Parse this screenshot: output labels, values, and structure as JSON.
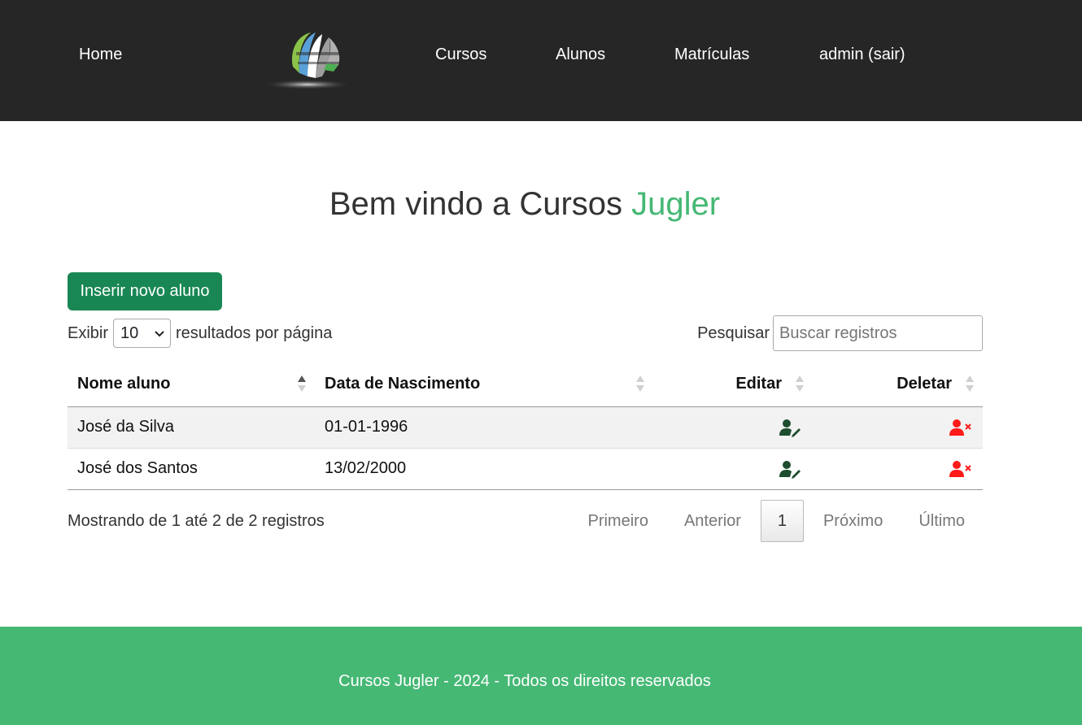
{
  "nav": {
    "home": "Home",
    "cursos": "Cursos",
    "alunos": "Alunos",
    "matriculas": "Matrículas",
    "admin": "admin (sair)"
  },
  "welcome": {
    "prefix": "Bem vindo a Cursos",
    "brand": "Jugler"
  },
  "insert_button": "Inserir novo aluno",
  "length_menu": {
    "prefix": "Exibir",
    "selected": "10",
    "suffix": "resultados por página"
  },
  "search": {
    "label": "Pesquisar",
    "placeholder": "Buscar registros"
  },
  "table": {
    "columns": [
      "Nome aluno",
      "Data de Nascimento",
      "Editar",
      "Deletar"
    ],
    "rows": [
      {
        "name": "José da Silva",
        "birth": "01-01-1996"
      },
      {
        "name": "José dos Santos",
        "birth": "13/02/2000"
      }
    ]
  },
  "info": "Mostrando de 1 até 2 de 2 registros",
  "pagination": {
    "first": "Primeiro",
    "previous": "Anterior",
    "current": "1",
    "next": "Próximo",
    "last": "Último"
  },
  "footer": "Cursos Jugler - 2024 - Todos os direitos reservados",
  "colors": {
    "header_bg": "#262626",
    "accent_green": "#45b874",
    "button_green": "#198754",
    "edit_icon": "#1d4d2f",
    "delete_icon": "#ff1a1a"
  },
  "icons": {
    "logo": "globe-logo",
    "edit": "user-edit-icon",
    "delete": "user-delete-icon",
    "sort": "sort-arrows-icon",
    "select": "chevron-down-icon"
  }
}
